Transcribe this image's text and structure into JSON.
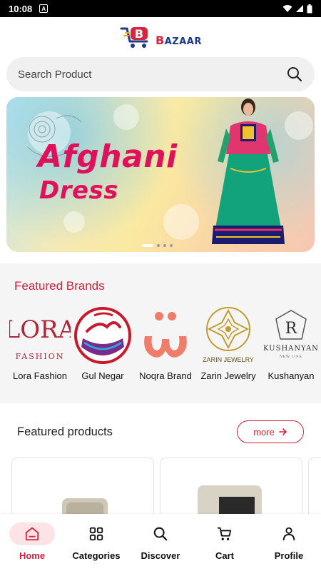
{
  "status_bar": {
    "time": "10:08",
    "notification_glyph": "A"
  },
  "header": {
    "logo_first": "B",
    "logo_rest": "AZAAR"
  },
  "search": {
    "placeholder": "Search Product"
  },
  "banner": {
    "title_line1": "Afghani",
    "title_line2": "Dress",
    "slide_count": 4,
    "active_slide": 1
  },
  "featured_brands": {
    "title": "Featured Brands",
    "items": [
      {
        "name": "Lora Fashion",
        "logo_text": "LORA",
        "logo_sub": "FASHION"
      },
      {
        "name": "Gul Negar"
      },
      {
        "name": "Noqra Brand"
      },
      {
        "name": "Zarin Jewelry",
        "logo_text": "ZARIN JEWELRY"
      },
      {
        "name": "Kushanyan",
        "logo_text": "KUSHANYAN",
        "logo_sub": "NEW LIFE"
      }
    ]
  },
  "featured_products": {
    "title": "Featured products",
    "more_label": "more"
  },
  "bottom_nav": {
    "items": [
      {
        "label": "Home",
        "icon": "home-icon",
        "active": true
      },
      {
        "label": "Categories",
        "icon": "grid-icon"
      },
      {
        "label": "Discover",
        "icon": "search-icon"
      },
      {
        "label": "Cart",
        "icon": "cart-icon"
      },
      {
        "label": "Profile",
        "icon": "profile-icon"
      }
    ]
  },
  "colors": {
    "accent": "#d71f3a",
    "accent_light": "#fde3e6",
    "brand_blue": "#1f3a8a",
    "banner_text": "#e0105a"
  }
}
